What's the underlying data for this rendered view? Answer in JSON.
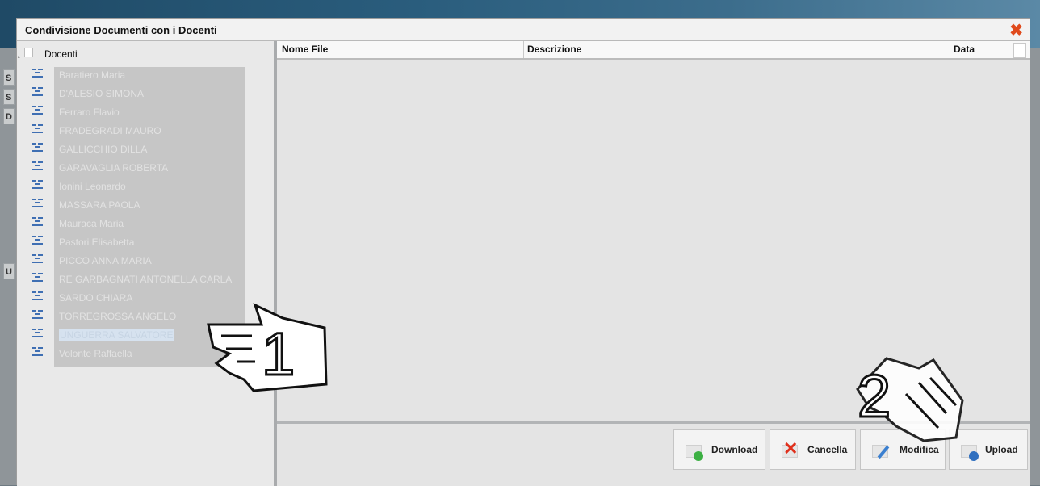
{
  "dialog": {
    "title": "Condivisione Documenti con i Docenti",
    "close_icon": "close-icon"
  },
  "background": {
    "peek_labels": [
      "S",
      "S",
      "D",
      "U"
    ]
  },
  "tree": {
    "root_label": "Docenti",
    "items": [
      {
        "name": "Baratiero Maria"
      },
      {
        "name": "D'ALESIO SIMONA"
      },
      {
        "name": "Ferraro Flavio"
      },
      {
        "name": "FRADEGRADI MAURO"
      },
      {
        "name": "GALLICCHIO DILLA"
      },
      {
        "name": "GARAVAGLIA ROBERTA"
      },
      {
        "name": "Ionini Leonardo"
      },
      {
        "name": "MASSARA PAOLA"
      },
      {
        "name": "Mauraca Maria"
      },
      {
        "name": "Pastori Elisabetta"
      },
      {
        "name": "PICCO ANNA MARIA"
      },
      {
        "name": "RE GARBAGNATI ANTONELLA CARLA"
      },
      {
        "name": "SARDO CHIARA"
      },
      {
        "name": "TORREGROSSA ANGELO"
      },
      {
        "name": "UNGUERRA SALVATORE",
        "selected": true
      },
      {
        "name": "Volonte Raffaella"
      }
    ]
  },
  "table": {
    "columns": [
      "Nome File",
      "Descrizione",
      "Data"
    ]
  },
  "buttons": {
    "download": "Download",
    "cancella": "Cancella",
    "modifica": "Modifica",
    "upload": "Upload"
  },
  "callouts": {
    "step1": "1",
    "step2": "2"
  },
  "colors": {
    "close": "#e04a1c",
    "download_dot": "#3cb043",
    "cancella_x": "#e0301c",
    "modifica_pencil": "#3a7fd0",
    "upload_dot": "#2f6fbf"
  }
}
